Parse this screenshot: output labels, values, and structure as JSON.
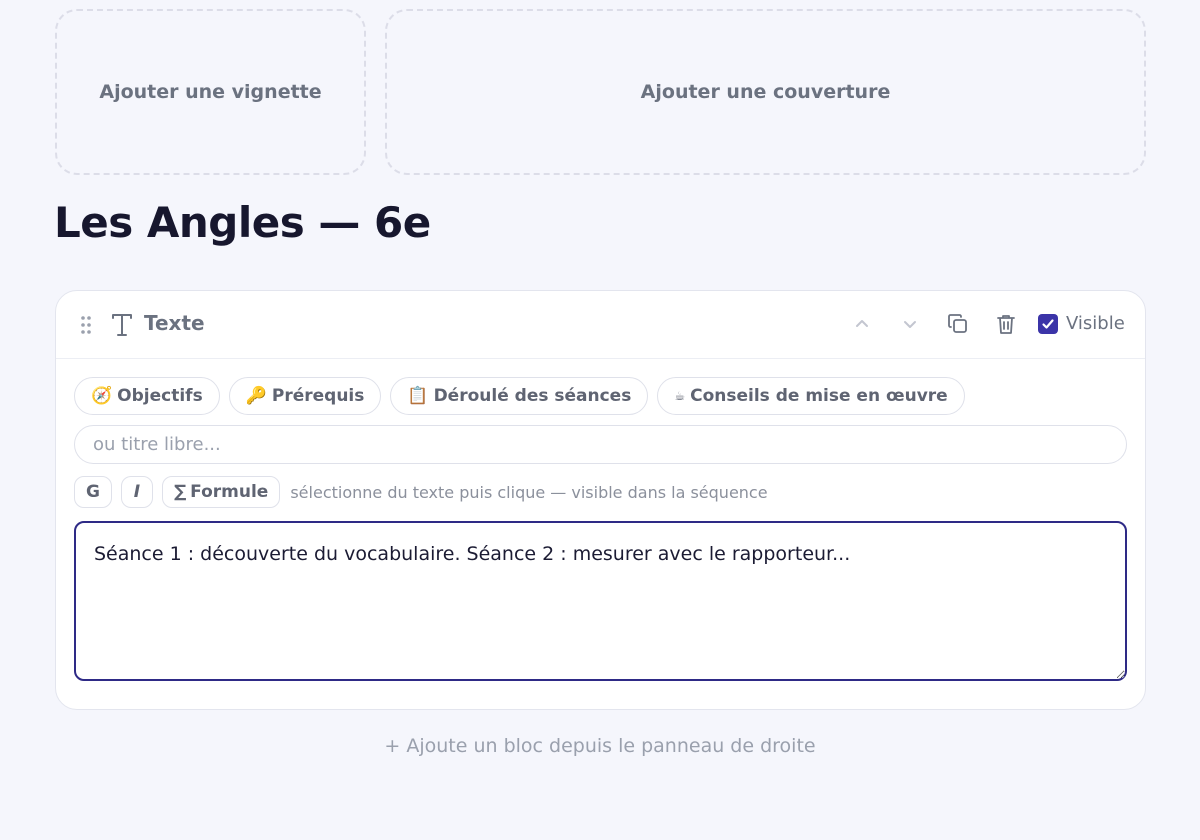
{
  "media": {
    "thumbnail_label": "Ajouter une vignette",
    "cover_label": "Ajouter une couverture"
  },
  "page": {
    "title": "Les Angles — 6e"
  },
  "block": {
    "type_label": "Texte",
    "visible_label": "Visible",
    "visible": true,
    "presets": [
      {
        "emoji": "🧭",
        "label": "Objectifs"
      },
      {
        "emoji": "🔑",
        "label": "Prérequis"
      },
      {
        "emoji": "📋",
        "label": "Déroulé des séances"
      },
      {
        "emoji": "☕",
        "label": "Conseils de mise en œuvre"
      }
    ],
    "title_placeholder": "ou titre libre...",
    "title_value": "",
    "format": {
      "bold_label": "G",
      "italic_label": "I",
      "formula_symbol": "∑",
      "formula_label": "Formule",
      "hint": "sélectionne du texte puis clique — visible dans la séquence"
    },
    "content": "Séance 1 : découverte du vocabulaire. Séance 2 : mesurer avec le rapporteur..."
  },
  "footer": {
    "add_block_hint": "+ Ajoute un bloc depuis le panneau de droite"
  },
  "colors": {
    "accent": "#3b34a8",
    "editor_border": "#2e2a86",
    "background": "#f5f6fc"
  },
  "icons": [
    "drag-handle-icon",
    "text-type-icon",
    "chevron-up-icon",
    "chevron-down-icon",
    "duplicate-icon",
    "trash-icon",
    "checkmark-icon"
  ]
}
